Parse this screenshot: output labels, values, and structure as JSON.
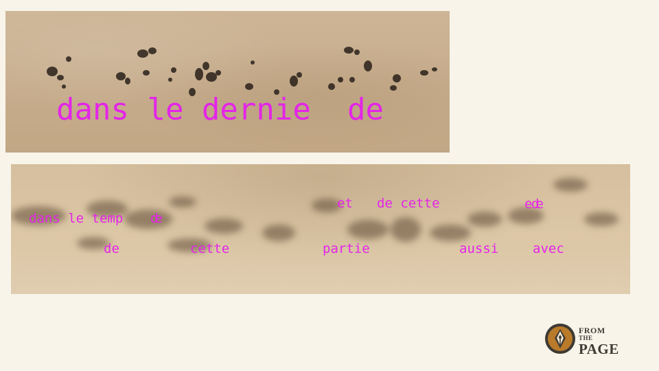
{
  "top_strip": {
    "words": [
      {
        "text": "dans le dernie"
      },
      {
        "text": "de"
      }
    ]
  },
  "bottom_strip": {
    "words": [
      {
        "text": "dans le temp"
      },
      {
        "text": "de"
      },
      {
        "text": "et"
      },
      {
        "text": "de cette"
      },
      {
        "text": "e"
      },
      {
        "text": "de"
      },
      {
        "text": "de"
      },
      {
        "text": "cette"
      },
      {
        "text": "partie"
      },
      {
        "text": "aussi"
      },
      {
        "text": "avec"
      }
    ]
  },
  "logo": {
    "line1": "FROM",
    "line2": "THE",
    "line3": "PAGE"
  },
  "colors": {
    "overlay_text": "#e424e8",
    "page_background": "#f8f4ea",
    "logo_badge": "#b97a2a"
  }
}
